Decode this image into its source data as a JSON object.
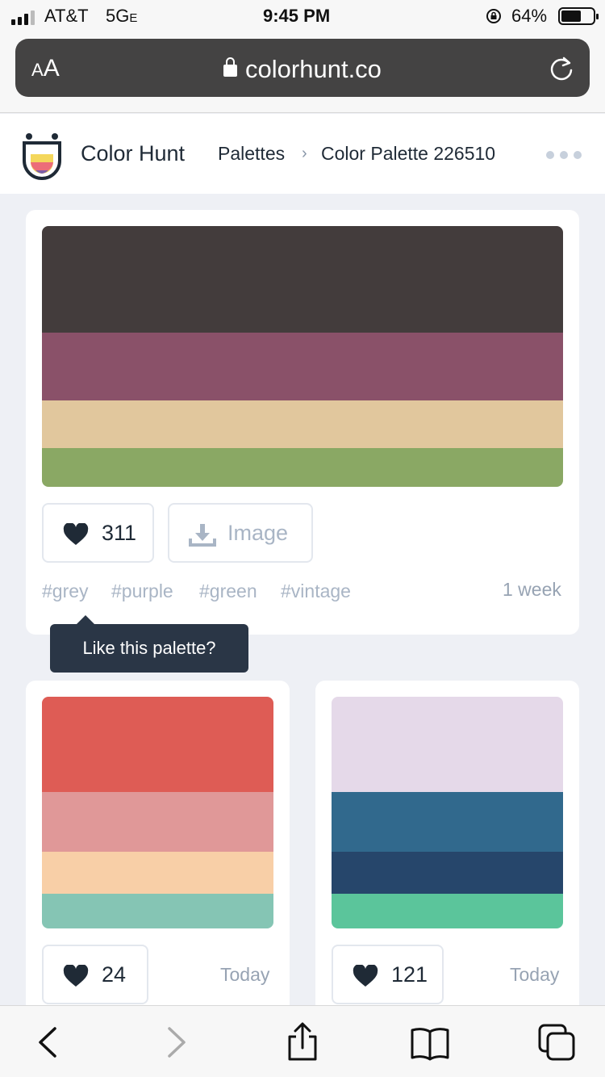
{
  "status_bar": {
    "carrier": "AT&T",
    "network": "5G",
    "network_sub": "E",
    "time": "9:45 PM",
    "battery": "64%",
    "battery_level": 0.64
  },
  "browser": {
    "text_size_label": "AA",
    "url": "colorhunt.co",
    "reload_icon": "reload-icon",
    "lock_icon": "lock-icon"
  },
  "site": {
    "brand": "Color Hunt",
    "breadcrumb": [
      "Palettes",
      "Color Palette 226510"
    ],
    "breadcrumb_separator": "›",
    "more_icon": "more-dots-icon"
  },
  "featured": {
    "colors": [
      "#433C3C",
      "#8A5169",
      "#E1C79D",
      "#8AA864"
    ],
    "likes": "311",
    "image_button": "Image",
    "tags": [
      "#grey",
      "#purple",
      "#green",
      "#vintage"
    ],
    "age": "1 week",
    "tooltip": "Like this palette?"
  },
  "palettes": [
    {
      "colors": [
        "#DE5C55",
        "#E09898",
        "#F8CFA7",
        "#85C5B4"
      ],
      "likes": "24",
      "age": "Today"
    },
    {
      "colors": [
        "#E5D9E9",
        "#31698D",
        "#26466B",
        "#5BC59B"
      ],
      "likes": "121",
      "age": "Today"
    }
  ],
  "toolbar": {
    "items": [
      "back-icon",
      "forward-icon",
      "share-icon",
      "bookmarks-icon",
      "tabs-icon"
    ]
  }
}
